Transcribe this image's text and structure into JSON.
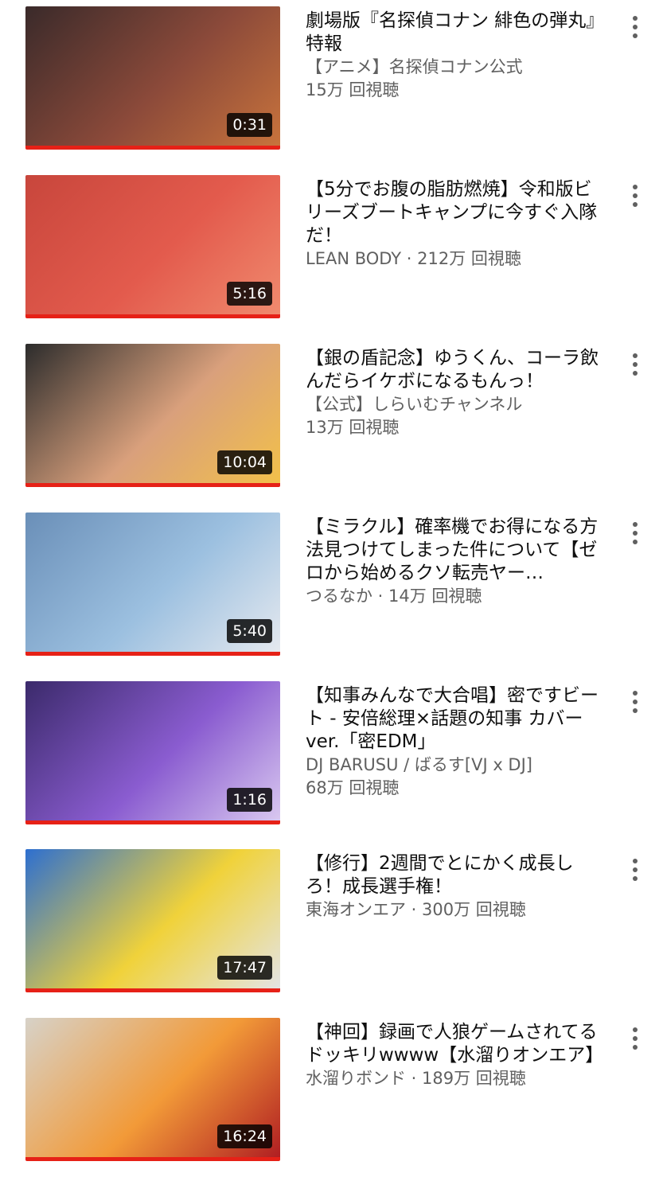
{
  "videos": [
    {
      "title": "劇場版『名探偵コナン 緋色の弾丸』特報",
      "line1": "【アニメ】名探偵コナン公式",
      "line2": "15万 回視聴",
      "duration": "0:31",
      "caption": "",
      "thumb_colors": [
        "#3a2a2a",
        "#8c4a3a",
        "#c8733c"
      ]
    },
    {
      "title": "【5分でお腹の脂肪燃焼】令和版ビリーズブートキャンプに今すぐ入隊だ！",
      "line1": "LEAN BODY · 212万 回視聴",
      "line2": "",
      "duration": "5:16",
      "caption": "",
      "thumb_colors": [
        "#c8463c",
        "#e35b4d",
        "#f08a6e"
      ]
    },
    {
      "title": "【銀の盾記念】ゆうくん、コーラ飲んだらイケボになるもんっ！",
      "line1": "【公式】しらいむチャンネル",
      "line2": "13万 回視聴",
      "duration": "10:04",
      "caption": "",
      "thumb_colors": [
        "#2c2c2c",
        "#d9a07c",
        "#f2c04a"
      ]
    },
    {
      "title": "【ミラクル】確率機でお得になる方法見つけてしまった件について【ゼロから始めるクソ転売ヤー…",
      "line1": "つるなか · 14万 回視聴",
      "line2": "",
      "duration": "5:40",
      "caption": "",
      "thumb_colors": [
        "#6a8fb8",
        "#9cc0e0",
        "#e5e9ef"
      ]
    },
    {
      "title": "【知事みんなで大合唱】密ですビート - 安倍総理×話題の知事 カバー ver.「密EDM」",
      "line1": "DJ BARUSU / ばるす[VJ x DJ]",
      "line2": "68万 回視聴",
      "duration": "1:16",
      "caption": "",
      "thumb_colors": [
        "#3b2a6b",
        "#8a5cd0",
        "#d9c8f0"
      ]
    },
    {
      "title": "【修行】2週間でとにかく成長しろ！成長選手権！",
      "line1": "東海オンエア · 300万 回視聴",
      "line2": "",
      "duration": "17:47",
      "caption": "",
      "thumb_colors": [
        "#2d6fd0",
        "#f0d23a",
        "#e4e4e4"
      ]
    },
    {
      "title": "【神回】録画で人狼ゲームされてるドッキリwwww【水溜りオンエア】",
      "line1": "水溜りボンド · 189万 回視聴",
      "line2": "",
      "duration": "16:24",
      "caption": "",
      "thumb_colors": [
        "#d7d2c8",
        "#f29a38",
        "#b01e22"
      ]
    }
  ]
}
